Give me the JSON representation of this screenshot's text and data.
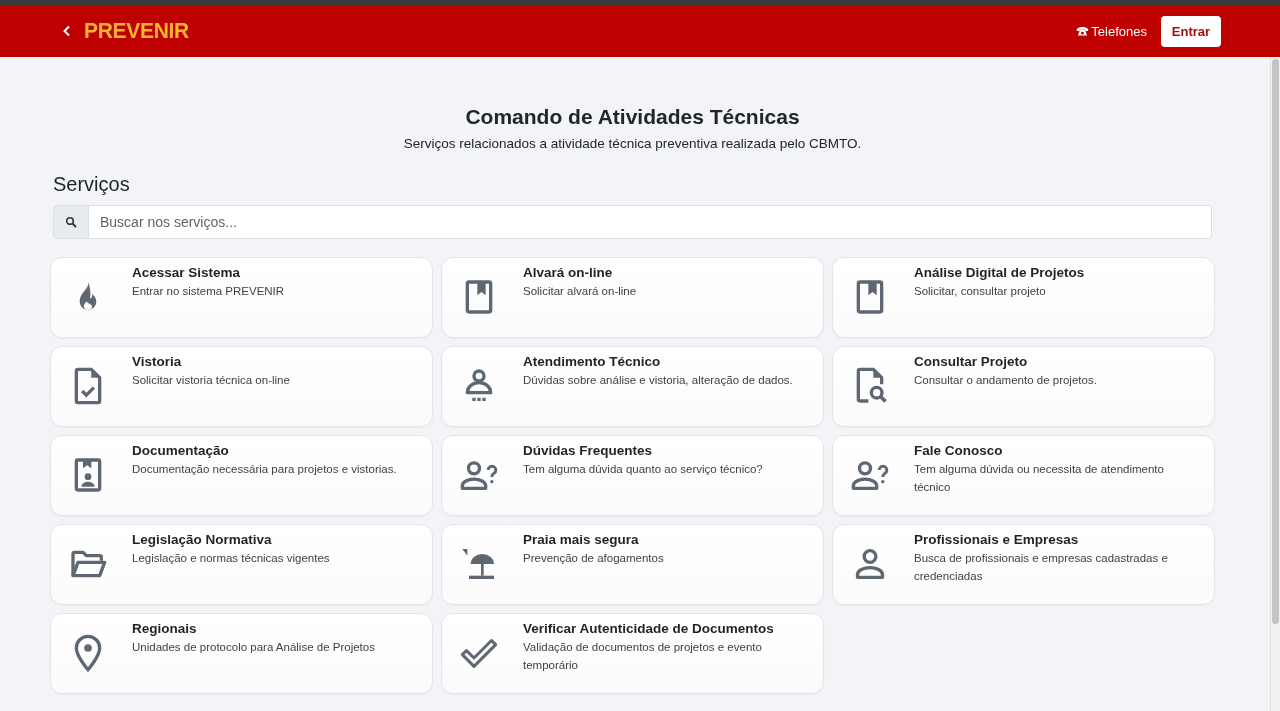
{
  "header": {
    "logo": "PREVENIR",
    "phone_link": "Telefones",
    "login_button": "Entrar"
  },
  "hero": {
    "title": "Comando de Atividades Técnicas",
    "subtitle": "Serviços relacionados a atividade técnica preventiva realizada pelo CBMTO."
  },
  "section_title": "Serviços",
  "search": {
    "placeholder": "Buscar nos serviços..."
  },
  "services": [
    {
      "kind": "flame",
      "title": "Acessar Sistema",
      "description": "Entrar no sistema PREVENIR"
    },
    {
      "kind": "book",
      "title": "Alvará on-line",
      "description": "Solicitar alvará on-line"
    },
    {
      "kind": "book",
      "title": "Análise Digital de Projetos",
      "description": "Solicitar, consultar projeto"
    },
    {
      "kind": "file-check",
      "title": "Vistoria",
      "description": "Solicitar vistoria técnica on-line"
    },
    {
      "kind": "person-desk",
      "title": "Atendimento Técnico",
      "description": "Dúvidas sobre análise e vistoria, alteração de dados."
    },
    {
      "kind": "file-search",
      "title": "Consultar Projeto",
      "description": "Consultar o andamento de projetos."
    },
    {
      "kind": "badge",
      "title": "Documentação",
      "description": "Documentação necessária para projetos e vistorias."
    },
    {
      "kind": "person-question",
      "title": "Dúvidas Frequentes",
      "description": "Tem alguma dúvida quanto ao serviço técnico?"
    },
    {
      "kind": "person-question",
      "title": "Fale Conosco",
      "description": "Tem alguma dúvida ou necessita de atendimento técnico"
    },
    {
      "kind": "folder",
      "title": "Legislação Normativa",
      "description": "Legislação e normas técnicas vigentes"
    },
    {
      "kind": "beach",
      "title": "Praia mais segura",
      "description": "Prevenção de afogamentos"
    },
    {
      "kind": "person",
      "title": "Profissionais e Empresas",
      "description": "Busca de profissionais e empresas cadastradas e credenciadas"
    },
    {
      "kind": "pin",
      "title": "Regionais",
      "description": "Unidades de protocolo para Análise de Projetos"
    },
    {
      "kind": "check",
      "title": "Verificar Autenticidade de Documentos",
      "description": "Validação de documentos de projetos e evento temporário"
    }
  ]
}
